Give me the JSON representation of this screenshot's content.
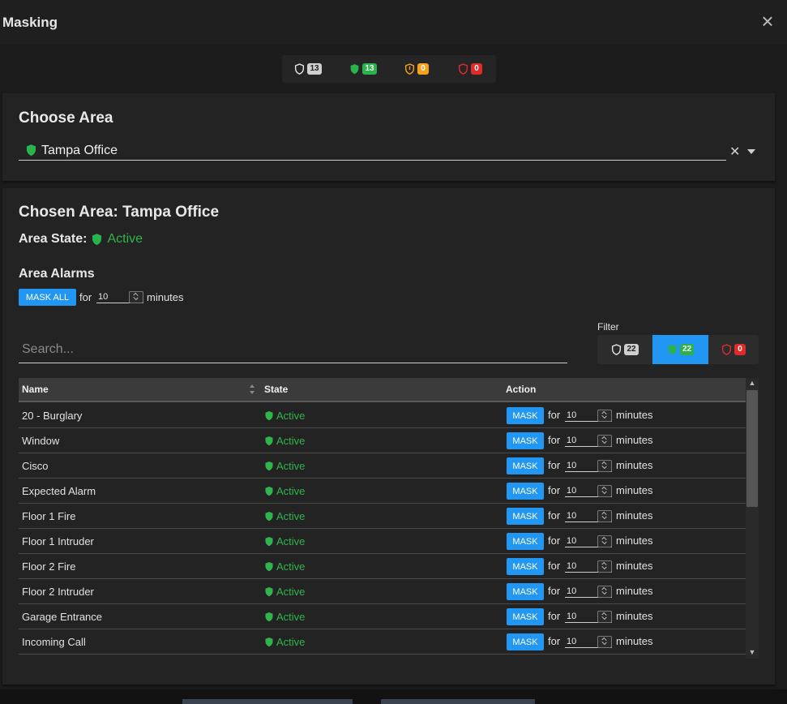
{
  "window": {
    "title": "Masking",
    "close_icon": "close-icon"
  },
  "summary": [
    {
      "icon": "shield-outline-icon",
      "count": "13",
      "color": "#cfcfcf"
    },
    {
      "icon": "shield-filled-green-icon",
      "count": "13",
      "color": "#2ab34a"
    },
    {
      "icon": "shield-warning-icon",
      "count": "0",
      "color": "#f2a31b"
    },
    {
      "icon": "shield-outline-red-icon",
      "count": "0",
      "color": "#e12b2b"
    }
  ],
  "choose_area": {
    "heading": "Choose Area",
    "selected": "Tampa Office",
    "clear_icon": "clear-icon",
    "dropdown_icon": "caret-down-icon"
  },
  "chosen": {
    "heading": "Chosen Area: Tampa Office",
    "state_label": "Area State:",
    "state_value": "Active",
    "alarms_heading": "Area Alarms",
    "mask_all_label": "MASK ALL",
    "for_label": "for",
    "minutes_value": "10",
    "minutes_label": "minutes"
  },
  "search": {
    "placeholder": "Search..."
  },
  "filter": {
    "label": "Filter",
    "buttons": [
      {
        "icon": "shield-outline-icon",
        "count": "22",
        "selected": false
      },
      {
        "icon": "shield-filled-icon",
        "count": "22",
        "selected": true
      },
      {
        "icon": "shield-outline-red-icon",
        "count": "0",
        "selected": false
      }
    ]
  },
  "table": {
    "columns": [
      "Name",
      "State",
      "Action"
    ],
    "mask_label": "MASK",
    "for_label": "for",
    "minutes_label": "minutes",
    "rows": [
      {
        "name": "20 - Burglary",
        "state": "Active",
        "minutes": "10"
      },
      {
        "name": "Window",
        "state": "Active",
        "minutes": "10"
      },
      {
        "name": "Cisco",
        "state": "Active",
        "minutes": "10"
      },
      {
        "name": "Expected Alarm",
        "state": "Active",
        "minutes": "10"
      },
      {
        "name": "Floor 1 Fire",
        "state": "Active",
        "minutes": "10"
      },
      {
        "name": "Floor 1 Intruder",
        "state": "Active",
        "minutes": "10"
      },
      {
        "name": "Floor 2 Fire",
        "state": "Active",
        "minutes": "10"
      },
      {
        "name": "Floor 2 Intruder",
        "state": "Active",
        "minutes": "10"
      },
      {
        "name": "Garage Entrance",
        "state": "Active",
        "minutes": "10"
      },
      {
        "name": "Incoming Call",
        "state": "Active",
        "minutes": "10"
      }
    ]
  },
  "colors": {
    "accent": "#2196f3",
    "active": "#2fb54b",
    "background": "#1c1c1c"
  }
}
